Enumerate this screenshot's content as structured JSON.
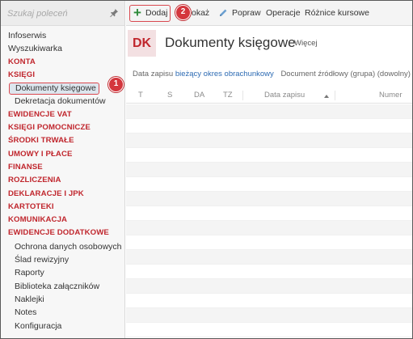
{
  "search": {
    "placeholder": "Szukaj poleceń"
  },
  "sidebar": {
    "items": [
      {
        "label": "Infoserwis",
        "kind": "plain"
      },
      {
        "label": "Wyszukiwarka",
        "kind": "plain"
      },
      {
        "label": "KONTA",
        "kind": "section"
      },
      {
        "label": "KSIĘGI",
        "kind": "section"
      },
      {
        "label": "Dokumenty księgowe",
        "kind": "selected"
      },
      {
        "label": "Dekretacja dokumentów",
        "kind": "sub"
      },
      {
        "label": "EWIDENCJE VAT",
        "kind": "section"
      },
      {
        "label": "KSIĘGI POMOCNICZE",
        "kind": "section"
      },
      {
        "label": "ŚRODKI TRWAŁE",
        "kind": "section"
      },
      {
        "label": "UMOWY I PŁACE",
        "kind": "section"
      },
      {
        "label": "FINANSE",
        "kind": "section"
      },
      {
        "label": "ROZLICZENIA",
        "kind": "section"
      },
      {
        "label": "DEKLARACJE I JPK",
        "kind": "section"
      },
      {
        "label": "KARTOTEKI",
        "kind": "section"
      },
      {
        "label": "KOMUNIKACJA",
        "kind": "section"
      },
      {
        "label": "EWIDENCJE DODATKOWE",
        "kind": "section"
      },
      {
        "label": "Ochrona danych osobowych",
        "kind": "sub"
      },
      {
        "label": "Ślad rewizyjny",
        "kind": "sub"
      },
      {
        "label": "Raporty",
        "kind": "sub"
      },
      {
        "label": "Biblioteka załączników",
        "kind": "sub"
      },
      {
        "label": "Naklejki",
        "kind": "sub"
      },
      {
        "label": "Notes",
        "kind": "sub"
      },
      {
        "label": "Konfiguracja",
        "kind": "sub"
      }
    ]
  },
  "callouts": {
    "first": "1",
    "second": "2"
  },
  "toolbar": {
    "add_label": "Dodaj",
    "show_label": "Pokaż",
    "fix_label": "Popraw",
    "operations_label": "Operacje",
    "exchange_label": "Różnice kursowe"
  },
  "header": {
    "badge": "DK",
    "title": "Dokumenty księgowe",
    "more": "Więcej"
  },
  "filters": {
    "date_label": "Data zapisu",
    "date_value": "bieżący okres obrachunkowy",
    "source_label": "Document źródłowy (grupa) (dowolny)"
  },
  "grid": {
    "columns": [
      "T",
      "S",
      "DA",
      "TZ",
      "Data zapisu",
      "Numer"
    ],
    "sorted_column": "Data zapisu",
    "sort_direction": "ascending"
  },
  "colors": {
    "accent_red": "#c0262d",
    "callout_red": "#d4363d",
    "link_blue": "#2d6bb3",
    "add_green": "#2e8b3a"
  }
}
